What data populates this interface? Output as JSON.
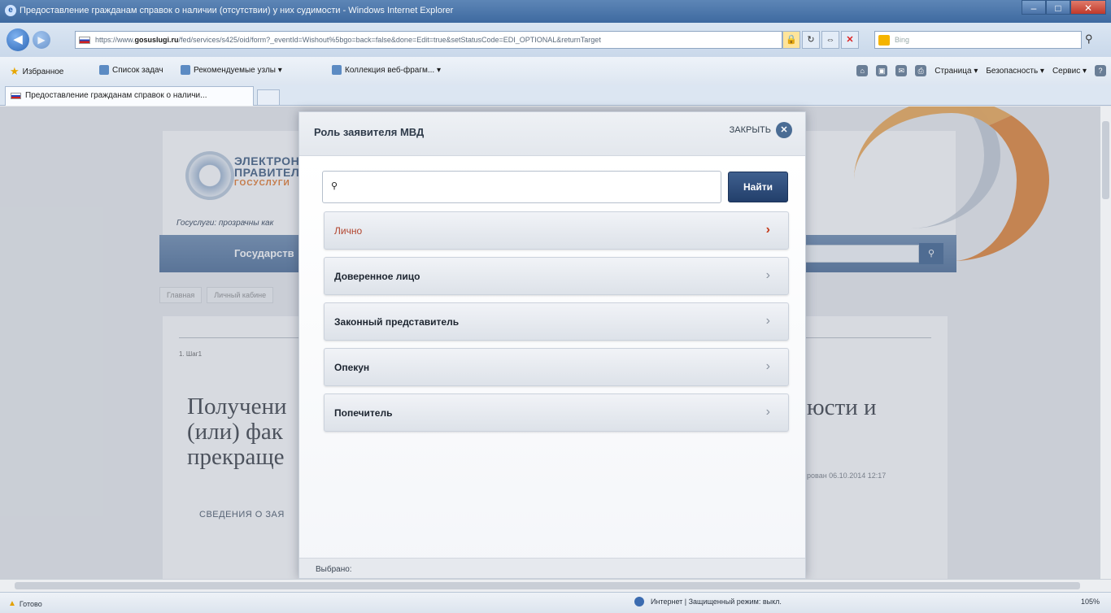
{
  "window": {
    "title": "Предоставление гражданам справок о наличии (отсутствии) у них судимости - Windows Internet Explorer",
    "min_glyph": "‒",
    "max_glyph": "□",
    "close_glyph": "✕"
  },
  "address": {
    "url_prefix": "https://www.",
    "url_host": "gosuslugi.ru",
    "url_rest": "/fed/services/s425/oid/form?_eventId=Wishout%5bgo=back=false&done=Edit=true&setStatusCode=EDI_OPTIONAL&returnTarget",
    "search_engine": "Bing",
    "search_placeholder": "Bing"
  },
  "favorites": {
    "favorites_label": "Избранное",
    "items": [
      "Список задач",
      "Рекомендуемые узлы ▾",
      "Коллекция веб-фрагм... ▾"
    ]
  },
  "commandbar": {
    "page": "Страница ▾",
    "safety": "Безопасность ▾",
    "tools": "Сервис ▾"
  },
  "tab": {
    "label": "Предоставление гражданам справок о наличи..."
  },
  "site": {
    "logo_line1": "ЭЛЕКТРОН",
    "logo_line2": "ПРАВИТЕЛ",
    "logo_line3": "ГОСУСЛУГИ",
    "tagline": "Госуслуги: прозрачны как",
    "nav_text": "Государств",
    "breadcrumb": [
      "Главная",
      "Личный кабине"
    ],
    "step": "1. Шаг1",
    "heading_left": "Получени\n(или) фак\nпрекраще",
    "heading_right": "юсти и",
    "date_text": "рован 06.10.2014 12:17",
    "section": "СВЕДЕНИЯ О ЗАЯ"
  },
  "modal": {
    "title": "Роль заявителя МВД",
    "close_label": "ЗАКРЫТЬ",
    "search_value": "",
    "search_placeholder": "",
    "find_label": "Найти",
    "roles": [
      {
        "label": "Лично",
        "active": true
      },
      {
        "label": "Доверенное лицо",
        "active": false
      },
      {
        "label": "Законный представитель",
        "active": false
      },
      {
        "label": "Опекун",
        "active": false
      },
      {
        "label": "Попечитель",
        "active": false
      }
    ],
    "selected_label": "Выбрано:"
  },
  "status": {
    "ready": "Готово",
    "zone": "Интернет | Защищенный режим: выкл.",
    "zoom": "105%"
  }
}
